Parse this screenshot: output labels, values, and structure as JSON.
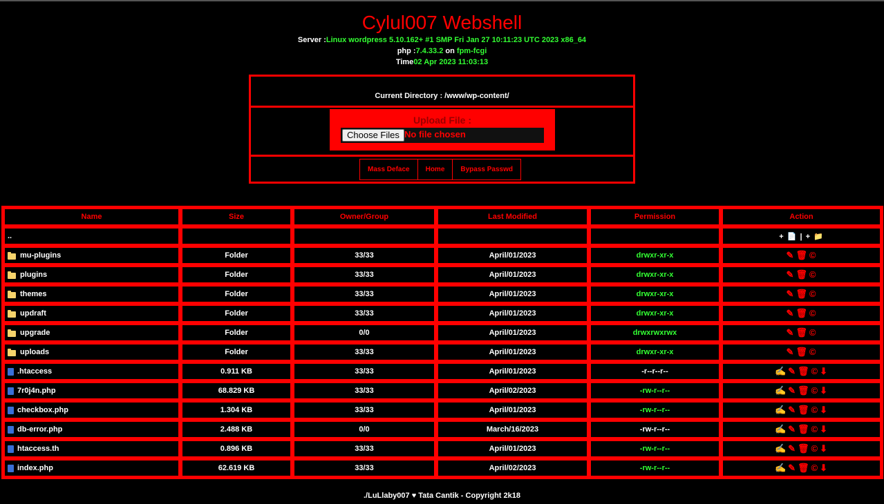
{
  "header": {
    "title": "Cylul007 Webshell",
    "server_label": "Server :",
    "server_value": "Linux wordpress 5.10.162+ #1 SMP Fri Jan 27 10:11:23 UTC 2023 x86_64",
    "php_label": "php :",
    "php_value": "7.4.33.2",
    "php_on": " on ",
    "php_sapi": "fpm-fcgi",
    "time_label": "Time",
    "time_value": "02 Apr 2023 11:03:13"
  },
  "panel": {
    "current_dir": "Current Directory : /www/wp-content/",
    "upload_title": "Upload File :",
    "choose_button": "Choose Files",
    "no_file": "No file chosen",
    "nav": [
      "Mass Deface",
      "Home",
      "Bypass Passwd"
    ]
  },
  "table": {
    "headers": [
      "Name",
      "Size",
      "Owner/Group",
      "Last Modified",
      "Permission",
      "Action"
    ],
    "parent": "..",
    "parent_action": "+ 📄 | + 📁",
    "rows": [
      {
        "type": "folder",
        "name": "mu-plugins",
        "size": "Folder",
        "owner": "33/33",
        "modified": "April/01/2023",
        "perm": "drwxr-xr-x",
        "perm_color": "#33ff33"
      },
      {
        "type": "folder",
        "name": "plugins",
        "size": "Folder",
        "owner": "33/33",
        "modified": "April/01/2023",
        "perm": "drwxr-xr-x",
        "perm_color": "#33ff33"
      },
      {
        "type": "folder",
        "name": "themes",
        "size": "Folder",
        "owner": "33/33",
        "modified": "April/01/2023",
        "perm": "drwxr-xr-x",
        "perm_color": "#33ff33"
      },
      {
        "type": "folder",
        "name": "updraft",
        "size": "Folder",
        "owner": "33/33",
        "modified": "April/01/2023",
        "perm": "drwxr-xr-x",
        "perm_color": "#33ff33"
      },
      {
        "type": "folder",
        "name": "upgrade",
        "size": "Folder",
        "owner": "0/0",
        "modified": "April/01/2023",
        "perm": "drwxrwxrwx",
        "perm_color": "#33ff33"
      },
      {
        "type": "folder",
        "name": "uploads",
        "size": "Folder",
        "owner": "33/33",
        "modified": "April/01/2023",
        "perm": "drwxr-xr-x",
        "perm_color": "#33ff33"
      },
      {
        "type": "file",
        "name": ".htaccess",
        "size": "0.911 KB",
        "owner": "33/33",
        "modified": "April/01/2023",
        "perm": "-r--r--r--",
        "perm_color": "#ffffff"
      },
      {
        "type": "file",
        "name": "7r0j4n.php",
        "size": "68.829 KB",
        "owner": "33/33",
        "modified": "April/02/2023",
        "perm": "-rw-r--r--",
        "perm_color": "#33ff33"
      },
      {
        "type": "file",
        "name": "checkbox.php",
        "size": "1.304 KB",
        "owner": "33/33",
        "modified": "April/01/2023",
        "perm": "-rw-r--r--",
        "perm_color": "#33ff33"
      },
      {
        "type": "file",
        "name": "db-error.php",
        "size": "2.488 KB",
        "owner": "0/0",
        "modified": "March/16/2023",
        "perm": "-rw-r--r--",
        "perm_color": "#ffffff"
      },
      {
        "type": "file",
        "name": "htaccess.th",
        "size": "0.896 KB",
        "owner": "33/33",
        "modified": "April/01/2023",
        "perm": "-rw-r--r--",
        "perm_color": "#33ff33"
      },
      {
        "type": "file",
        "name": "index.php",
        "size": "62.619 KB",
        "owner": "33/33",
        "modified": "April/02/2023",
        "perm": "-rw-r--r--",
        "perm_color": "#33ff33"
      }
    ]
  },
  "footer": "./LuLlaby007 ♥ Tata Cantik - Copyright 2k18"
}
